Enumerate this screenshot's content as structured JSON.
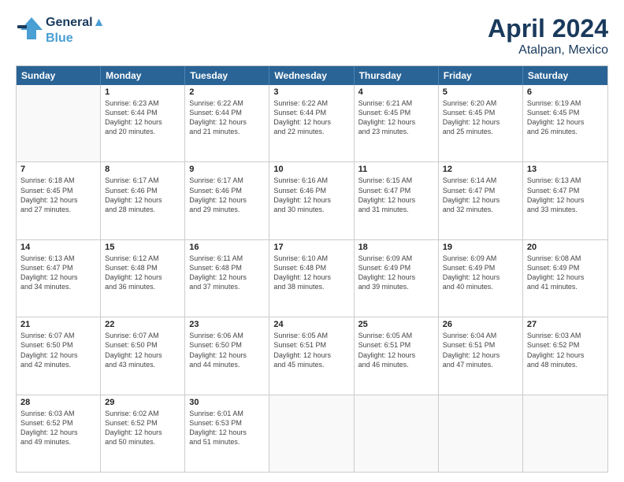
{
  "header": {
    "logo_line1": "General",
    "logo_line2": "Blue",
    "month": "April 2024",
    "location": "Atalpan, Mexico"
  },
  "weekdays": [
    "Sunday",
    "Monday",
    "Tuesday",
    "Wednesday",
    "Thursday",
    "Friday",
    "Saturday"
  ],
  "weeks": [
    [
      {
        "day": "",
        "sunrise": "",
        "sunset": "",
        "daylight": ""
      },
      {
        "day": "1",
        "sunrise": "Sunrise: 6:23 AM",
        "sunset": "Sunset: 6:44 PM",
        "daylight": "Daylight: 12 hours",
        "daylight2": "and 20 minutes."
      },
      {
        "day": "2",
        "sunrise": "Sunrise: 6:22 AM",
        "sunset": "Sunset: 6:44 PM",
        "daylight": "Daylight: 12 hours",
        "daylight2": "and 21 minutes."
      },
      {
        "day": "3",
        "sunrise": "Sunrise: 6:22 AM",
        "sunset": "Sunset: 6:44 PM",
        "daylight": "Daylight: 12 hours",
        "daylight2": "and 22 minutes."
      },
      {
        "day": "4",
        "sunrise": "Sunrise: 6:21 AM",
        "sunset": "Sunset: 6:45 PM",
        "daylight": "Daylight: 12 hours",
        "daylight2": "and 23 minutes."
      },
      {
        "day": "5",
        "sunrise": "Sunrise: 6:20 AM",
        "sunset": "Sunset: 6:45 PM",
        "daylight": "Daylight: 12 hours",
        "daylight2": "and 25 minutes."
      },
      {
        "day": "6",
        "sunrise": "Sunrise: 6:19 AM",
        "sunset": "Sunset: 6:45 PM",
        "daylight": "Daylight: 12 hours",
        "daylight2": "and 26 minutes."
      }
    ],
    [
      {
        "day": "7",
        "sunrise": "Sunrise: 6:18 AM",
        "sunset": "Sunset: 6:45 PM",
        "daylight": "Daylight: 12 hours",
        "daylight2": "and 27 minutes."
      },
      {
        "day": "8",
        "sunrise": "Sunrise: 6:17 AM",
        "sunset": "Sunset: 6:46 PM",
        "daylight": "Daylight: 12 hours",
        "daylight2": "and 28 minutes."
      },
      {
        "day": "9",
        "sunrise": "Sunrise: 6:17 AM",
        "sunset": "Sunset: 6:46 PM",
        "daylight": "Daylight: 12 hours",
        "daylight2": "and 29 minutes."
      },
      {
        "day": "10",
        "sunrise": "Sunrise: 6:16 AM",
        "sunset": "Sunset: 6:46 PM",
        "daylight": "Daylight: 12 hours",
        "daylight2": "and 30 minutes."
      },
      {
        "day": "11",
        "sunrise": "Sunrise: 6:15 AM",
        "sunset": "Sunset: 6:47 PM",
        "daylight": "Daylight: 12 hours",
        "daylight2": "and 31 minutes."
      },
      {
        "day": "12",
        "sunrise": "Sunrise: 6:14 AM",
        "sunset": "Sunset: 6:47 PM",
        "daylight": "Daylight: 12 hours",
        "daylight2": "and 32 minutes."
      },
      {
        "day": "13",
        "sunrise": "Sunrise: 6:13 AM",
        "sunset": "Sunset: 6:47 PM",
        "daylight": "Daylight: 12 hours",
        "daylight2": "and 33 minutes."
      }
    ],
    [
      {
        "day": "14",
        "sunrise": "Sunrise: 6:13 AM",
        "sunset": "Sunset: 6:47 PM",
        "daylight": "Daylight: 12 hours",
        "daylight2": "and 34 minutes."
      },
      {
        "day": "15",
        "sunrise": "Sunrise: 6:12 AM",
        "sunset": "Sunset: 6:48 PM",
        "daylight": "Daylight: 12 hours",
        "daylight2": "and 36 minutes."
      },
      {
        "day": "16",
        "sunrise": "Sunrise: 6:11 AM",
        "sunset": "Sunset: 6:48 PM",
        "daylight": "Daylight: 12 hours",
        "daylight2": "and 37 minutes."
      },
      {
        "day": "17",
        "sunrise": "Sunrise: 6:10 AM",
        "sunset": "Sunset: 6:48 PM",
        "daylight": "Daylight: 12 hours",
        "daylight2": "and 38 minutes."
      },
      {
        "day": "18",
        "sunrise": "Sunrise: 6:09 AM",
        "sunset": "Sunset: 6:49 PM",
        "daylight": "Daylight: 12 hours",
        "daylight2": "and 39 minutes."
      },
      {
        "day": "19",
        "sunrise": "Sunrise: 6:09 AM",
        "sunset": "Sunset: 6:49 PM",
        "daylight": "Daylight: 12 hours",
        "daylight2": "and 40 minutes."
      },
      {
        "day": "20",
        "sunrise": "Sunrise: 6:08 AM",
        "sunset": "Sunset: 6:49 PM",
        "daylight": "Daylight: 12 hours",
        "daylight2": "and 41 minutes."
      }
    ],
    [
      {
        "day": "21",
        "sunrise": "Sunrise: 6:07 AM",
        "sunset": "Sunset: 6:50 PM",
        "daylight": "Daylight: 12 hours",
        "daylight2": "and 42 minutes."
      },
      {
        "day": "22",
        "sunrise": "Sunrise: 6:07 AM",
        "sunset": "Sunset: 6:50 PM",
        "daylight": "Daylight: 12 hours",
        "daylight2": "and 43 minutes."
      },
      {
        "day": "23",
        "sunrise": "Sunrise: 6:06 AM",
        "sunset": "Sunset: 6:50 PM",
        "daylight": "Daylight: 12 hours",
        "daylight2": "and 44 minutes."
      },
      {
        "day": "24",
        "sunrise": "Sunrise: 6:05 AM",
        "sunset": "Sunset: 6:51 PM",
        "daylight": "Daylight: 12 hours",
        "daylight2": "and 45 minutes."
      },
      {
        "day": "25",
        "sunrise": "Sunrise: 6:05 AM",
        "sunset": "Sunset: 6:51 PM",
        "daylight": "Daylight: 12 hours",
        "daylight2": "and 46 minutes."
      },
      {
        "day": "26",
        "sunrise": "Sunrise: 6:04 AM",
        "sunset": "Sunset: 6:51 PM",
        "daylight": "Daylight: 12 hours",
        "daylight2": "and 47 minutes."
      },
      {
        "day": "27",
        "sunrise": "Sunrise: 6:03 AM",
        "sunset": "Sunset: 6:52 PM",
        "daylight": "Daylight: 12 hours",
        "daylight2": "and 48 minutes."
      }
    ],
    [
      {
        "day": "28",
        "sunrise": "Sunrise: 6:03 AM",
        "sunset": "Sunset: 6:52 PM",
        "daylight": "Daylight: 12 hours",
        "daylight2": "and 49 minutes."
      },
      {
        "day": "29",
        "sunrise": "Sunrise: 6:02 AM",
        "sunset": "Sunset: 6:52 PM",
        "daylight": "Daylight: 12 hours",
        "daylight2": "and 50 minutes."
      },
      {
        "day": "30",
        "sunrise": "Sunrise: 6:01 AM",
        "sunset": "Sunset: 6:53 PM",
        "daylight": "Daylight: 12 hours",
        "daylight2": "and 51 minutes."
      },
      {
        "day": "",
        "sunrise": "",
        "sunset": "",
        "daylight": "",
        "daylight2": ""
      },
      {
        "day": "",
        "sunrise": "",
        "sunset": "",
        "daylight": "",
        "daylight2": ""
      },
      {
        "day": "",
        "sunrise": "",
        "sunset": "",
        "daylight": "",
        "daylight2": ""
      },
      {
        "day": "",
        "sunrise": "",
        "sunset": "",
        "daylight": "",
        "daylight2": ""
      }
    ]
  ]
}
